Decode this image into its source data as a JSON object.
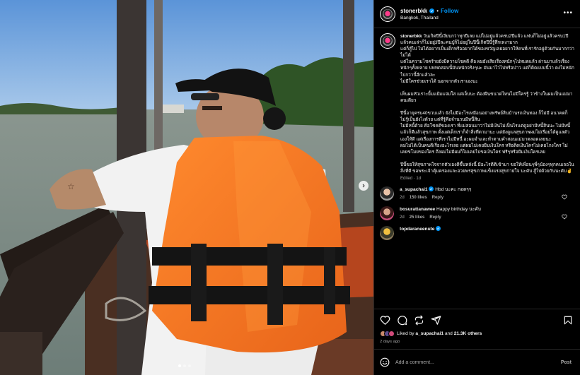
{
  "post": {
    "username": "stonerbkk",
    "follow_label": "Follow",
    "dot": "•",
    "location": "Bangkok, Thailand",
    "more_label": "•••",
    "caption_text": "วันเกิดปีนี้เงียบกว่าทุกปีเลย แม่ไม่อยู่แล้วครบ2ปีแล้ว แฟนก็ไม่อยู่แล้วครบ1ปีแล้วคนเล่าก็ไม่อยู่3ปีละคนปู่ก็ไม่อยู่ในปีนี้เกิดปีนี้รู้สึกเหงามาก\nแต่ก็สู้ไป ไม่ได้อยากเป็นเด็กหรืออยากได้ของขวัญเลยอยากให้คนที่เรารักอยู่ด้วยกันมากกว่าไม่ได้\nแต่ในความโชคร้ายยังมีความโชคดี คือ ผมยังเสียเรื่องหนักๆไปหมดแล้ว ผ่านมาแล้วเรื่องหนักๆทั้งหลาย บททดสอบนี้มันหนักจริงๆนะ มันมาไวไปหรือป่าว แต่ก็คิดแบบนี้ว่า คงไม่หนักไปกว่านี้อีกแล้วละ\nไม่มีใครช่วยเราได้ นอกจากตัวเราเองนะ\n\nเห็นผมหัวเราะยิ้มแย้มแจ่มใส แต่เจ็บนะ ต้องฝืนขนาดไหนไม่มีใครรู้ ว่าข้างในผมเป็นแม่มาคนเดียว\n\nปีนี้อายุครบ40ขวบแล้ว ยังไม่มีอะไรเหมือนอย่างทรัพย์สินบ้านรถเงินทอง ก็ไม่มี อนาคตก็ไม่รู้เป็นยังไงด้วย แต่ที่รู้คือจำนวนมีหนี้สิน\nไม่มีหนี้ด้วย คือโชคดีของเรา ที่แม่สอนมาว่าไม่มีเงินไม่เป็นไรแต่ดูอย่ามีหนี้สินนะ ไม่มีหนี้แล้วก็ดีแล้วสุขภาพ ตั้งแต่เด็กเราก็จำสิ่งที่ตามานะ แต่ยังดูแลสุขภาพผมไม่เรื่อยได้ดูแลตัวเองให้ดี แต่เรื่องการที่เราไม่มีหนี้ อะผมจำและทำตามคำสอนแม่มาตลอดเลยนะ\nผมไม่ได้เป็นคนดีเรื่องอะไรเลย แต่ผมไม่เคยยืมเงินใคร หรือติดเงินใครไม่เคยโกงใคร ไม่เคยขโมยของใคร ถึงผมไม่มีผมก็ไม่เคยไปขอเงินใคร ฟรีๆหรือยืมเงินใครเลย\n\nปีนี้ขอให้สุขภาพใจจากตัวเองดีขึ้นหลังนี้ มีอะไรดีดีเข้ามา ขอให้เพื่อนๆพี่ๆน้องๆทุกคนเจอในสิ่งที่ดี ขอพระเจ้าคุ้มครองและอวยพรสุขภาพแข็งแรงสุขกายใจ นะคับ สู้ไปด้วยกันนะคับ✌️",
    "edited": "Edited · 1d"
  },
  "comments": [
    {
      "user": "a_supachai1",
      "text": "Hbd นะคะ กอดๆๆ",
      "age": "2d",
      "likes": "150 likes",
      "reply": "Reply"
    },
    {
      "user": "bosurattanawee",
      "text": "Happy birthday นะคับ",
      "age": "2d",
      "likes": "25 likes",
      "reply": "Reply"
    },
    {
      "user": "topdaraneenute",
      "text": "",
      "age": "",
      "likes": "",
      "reply": ""
    }
  ],
  "likes": {
    "prefix": "Liked by",
    "user": "a_supachai1",
    "and": "and",
    "count": "21.3K others"
  },
  "time_ago": "2 days ago",
  "comment_bar": {
    "placeholder": "Add a comment...",
    "post_label": "Post"
  },
  "colors": {
    "accent": "#0095f6",
    "life_jacket": "#f47a21",
    "background": "#000000"
  },
  "icons": [
    "heart-icon",
    "comment-icon",
    "repost-icon",
    "share-icon",
    "bookmark-icon",
    "emoji-icon",
    "verified-icon",
    "chevron-right-icon"
  ]
}
